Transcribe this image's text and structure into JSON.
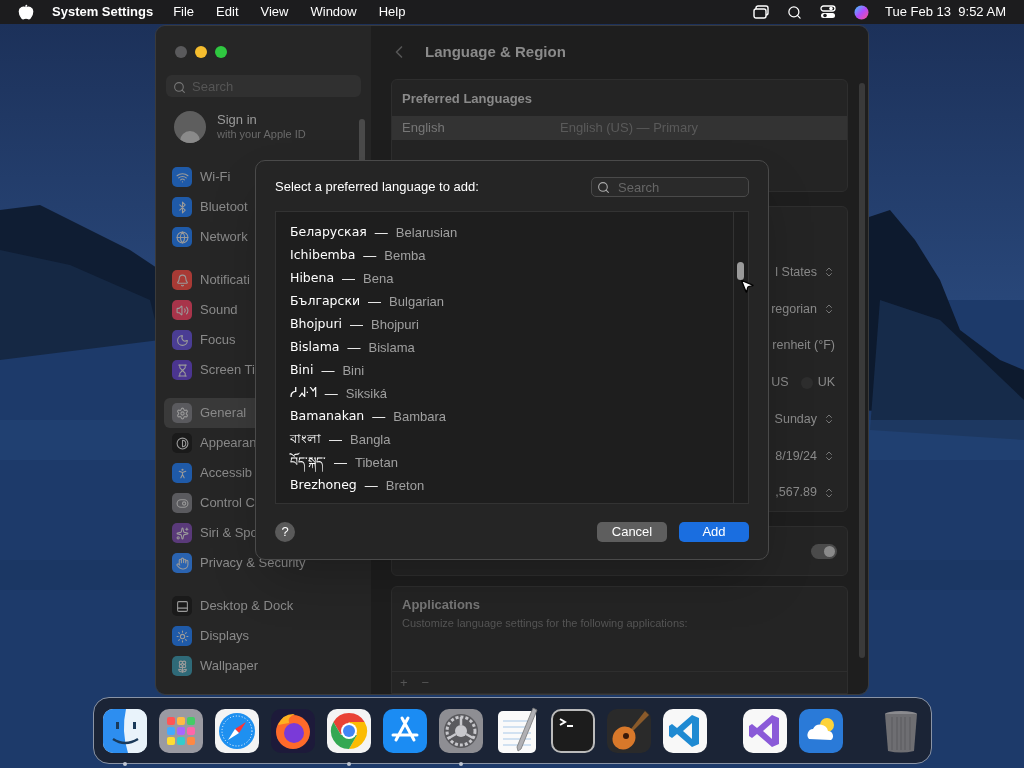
{
  "menu_bar": {
    "app_name": "System Settings",
    "menus": [
      "File",
      "Edit",
      "View",
      "Window",
      "Help"
    ],
    "clock": "Tue Feb 13  9:52 AM"
  },
  "window": {
    "title": "Language & Region",
    "sidebar": {
      "search": {
        "placeholder": "Search"
      },
      "account": {
        "title": "Sign in",
        "subtitle": "with your Apple ID"
      },
      "groups": [
        {
          "items": [
            {
              "label": "Wi-Fi",
              "color": "#1f5aa8",
              "selected": false
            },
            {
              "label": "Bluetoot",
              "color": "#1f5aa8",
              "selected": false
            },
            {
              "label": "Network",
              "color": "#1f5aa8",
              "selected": false
            }
          ]
        },
        {
          "items": [
            {
              "label": "Notificati",
              "color": "#a83a35",
              "selected": false
            },
            {
              "label": "Sound",
              "color": "#a8344a",
              "selected": false
            },
            {
              "label": "Focus",
              "color": "#4a3d94",
              "selected": false
            },
            {
              "label": "Screen Ti",
              "color": "#4b3590",
              "selected": false
            }
          ]
        },
        {
          "items": [
            {
              "label": "General",
              "color": "#5a5a5e",
              "selected": true
            },
            {
              "label": "Appearan",
              "color": "#1a1a1a",
              "selected": false
            },
            {
              "label": "Accessib",
              "color": "#1f5aa8",
              "selected": false
            },
            {
              "label": "Control C",
              "color": "#5a5a5e",
              "selected": false
            },
            {
              "label": "Siri & Spo",
              "color": "#5a3a7a",
              "selected": false
            },
            {
              "label": "Privacy & Security",
              "color": "#2a63b0",
              "selected": false
            }
          ]
        },
        {
          "items": [
            {
              "label": "Desktop & Dock",
              "color": "#1a1a1a",
              "selected": false
            },
            {
              "label": "Displays",
              "color": "#1f5aa8",
              "selected": false
            },
            {
              "label": "Wallpaper",
              "color": "#2f6a78",
              "selected": false
            }
          ]
        }
      ]
    },
    "preferred_languages": {
      "title": "Preferred Languages",
      "rows": [
        {
          "language": "English",
          "detail": "English (US) — Primary",
          "selected": true
        }
      ]
    },
    "settings_rows": [
      {
        "kind": "popup",
        "value": "l States"
      },
      {
        "kind": "popup",
        "value": "regorian"
      },
      {
        "kind": "text",
        "value": "renheit (°F)"
      },
      {
        "kind": "radios",
        "options": [
          {
            "label": "US"
          },
          {
            "label": "UK",
            "selected": false
          }
        ]
      },
      {
        "kind": "popup",
        "value": "Sunday"
      },
      {
        "kind": "popup",
        "value": "8/19/24"
      },
      {
        "kind": "popup",
        "value": ",567.89"
      }
    ],
    "toggle": {
      "on": true
    },
    "applications": {
      "title": "Applications",
      "description": "Customize language settings for the following applications:",
      "add": "+",
      "remove": "−"
    }
  },
  "dialog": {
    "title": "Select a preferred language to add:",
    "search": {
      "placeholder": "Search"
    },
    "languages": [
      {
        "native": "Беларуская",
        "dash": "—",
        "english": "Belarusian"
      },
      {
        "native": "Ichibemba",
        "dash": "—",
        "english": "Bemba"
      },
      {
        "native": "Hibena",
        "dash": "—",
        "english": "Bena"
      },
      {
        "native": "Български",
        "dash": "—",
        "english": "Bulgarian"
      },
      {
        "native": "Bhojpuri",
        "dash": "—",
        "english": "Bhojpuri"
      },
      {
        "native": "Bislama",
        "dash": "—",
        "english": "Bislama"
      },
      {
        "native": "Bini",
        "dash": "—",
        "english": "Bini"
      },
      {
        "native": "ᓱᖽᐧᖿ",
        "dash": "—",
        "english": "Siksiká"
      },
      {
        "native": "Bamanakan",
        "dash": "—",
        "english": "Bambara"
      },
      {
        "native": "বাংলা",
        "dash": "—",
        "english": "Bangla"
      },
      {
        "native": "བོད་སྐད་",
        "dash": "—",
        "english": "Tibetan"
      },
      {
        "native": "Brezhoneg",
        "dash": "—",
        "english": "Breton"
      }
    ],
    "help": "?",
    "cancel": "Cancel",
    "add": "Add"
  },
  "dock": {
    "apps": [
      {
        "kind": "finder",
        "running": true
      },
      {
        "kind": "launchpad",
        "running": false
      },
      {
        "kind": "safari",
        "running": false
      },
      {
        "kind": "firefox",
        "running": false
      },
      {
        "kind": "chrome",
        "running": true
      },
      {
        "kind": "appstore",
        "running": false
      },
      {
        "kind": "settings",
        "running": true
      },
      {
        "kind": "textedit",
        "running": false
      },
      {
        "kind": "terminal",
        "running": false
      },
      {
        "kind": "garageband",
        "running": false
      },
      {
        "kind": "vscode",
        "running": false
      },
      {
        "kind": "separator"
      },
      {
        "kind": "visualstudio",
        "running": false
      },
      {
        "kind": "weather",
        "running": false
      },
      {
        "kind": "separator"
      },
      {
        "kind": "trash",
        "running": false
      }
    ]
  }
}
